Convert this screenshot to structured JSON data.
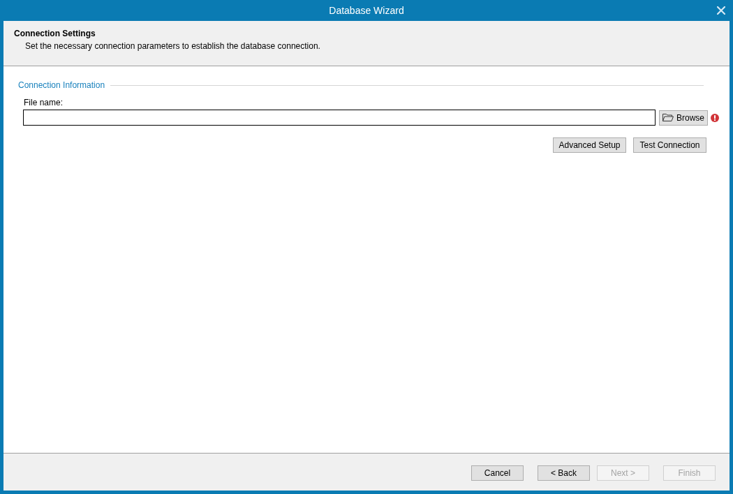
{
  "window": {
    "title": "Database Wizard"
  },
  "header": {
    "title": "Connection Settings",
    "description": "Set the necessary connection parameters to establish the database connection."
  },
  "group": {
    "title": "Connection Information",
    "fields": [
      {
        "label": "File name:",
        "button": "Browse",
        "error": true
      }
    ],
    "actions": [
      "Advanced Setup",
      "Test Connection"
    ]
  },
  "footer_buttons": [
    {
      "label": "Cancel",
      "disabled": false
    },
    {
      "label": "< Back",
      "disabled": false
    },
    {
      "label": "Next >",
      "disabled": true
    },
    {
      "label": "Finish",
      "disabled": true
    }
  ]
}
